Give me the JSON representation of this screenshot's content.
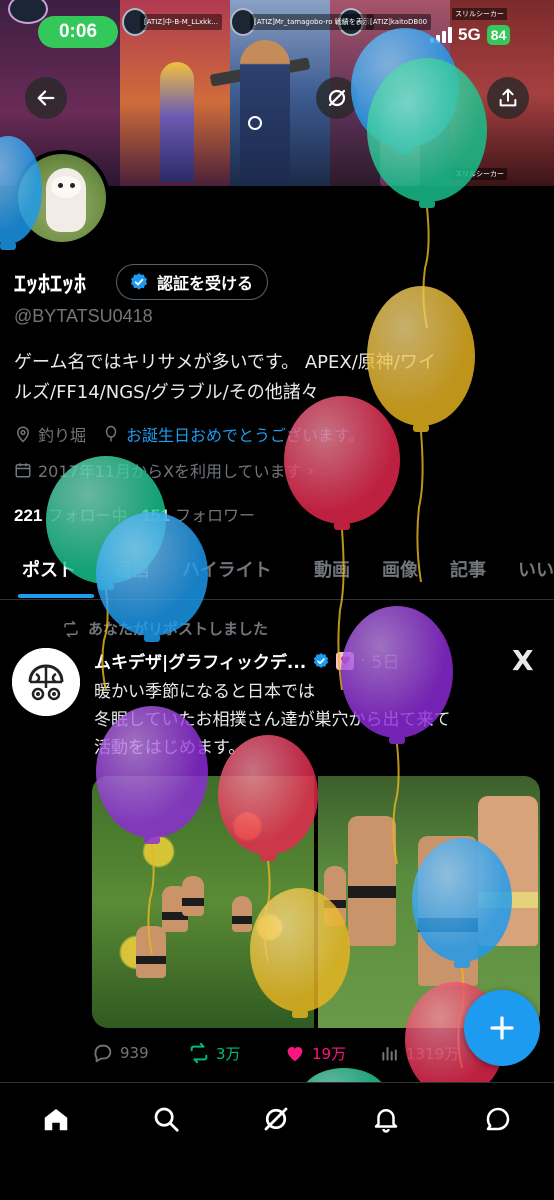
{
  "status_bar": {
    "time": "0:06",
    "network": "5G",
    "battery": "84"
  },
  "banner": {
    "tags": [
      "[ATIZ]中-B-M_LLxkk...",
      "[ATIZ]Mr_tamagobo-ro 戦績を表示",
      "[ATIZ]kaitoDB00"
    ],
    "game_labels": [
      "スリルシーカー",
      "スリルシーカー"
    ]
  },
  "header": {
    "back_icon": "back-arrow-icon",
    "grok_icon": "grok-icon",
    "share_icon": "share-icon"
  },
  "profile": {
    "display_name": "ｴｯﾎｴｯﾎ",
    "verify_label": "認証を受ける",
    "handle": "@BYTATSU0418",
    "bio_line1": "ゲーム名ではキリサメが多いです。 APEX/原神/ワイ",
    "bio_line2": "ルズ/FF14/NGS/グラブル/その他諸々",
    "location": "釣り堀",
    "birthday": "お誕生日おめでとうございます。",
    "joined": "2017年11月からXを利用しています",
    "following_count": "221",
    "following_label": "フォロー中",
    "followers_count": "151",
    "followers_label": "フォロワー"
  },
  "tabs": [
    {
      "label": "ポスト",
      "active": true
    },
    {
      "label": "返信"
    },
    {
      "label": "ハイライト"
    },
    {
      "label": "動画"
    },
    {
      "label": "画像"
    },
    {
      "label": "記事"
    },
    {
      "label": "いい"
    }
  ],
  "tweet": {
    "repost_label": "あなたがリポストしました",
    "author": "ムキデザ|グラフィックデ...",
    "date": "5日",
    "text_line1": "暖かい季節になると日本では",
    "text_line2": "冬眠していたお相撲さん達が巣穴から出て来て",
    "text_line3": "活動をはじめます。",
    "replies": "939",
    "reposts": "3万",
    "likes": "19万",
    "views": "1319万"
  },
  "colors": {
    "accent": "#1d9bf0",
    "repost": "#00ba7c",
    "like": "#f91880",
    "status_green": "#34c759"
  },
  "balloon_colors": [
    "#1d9bf0",
    "#18c58f",
    "#e9b521",
    "#e8294f",
    "#8e2bd9"
  ]
}
